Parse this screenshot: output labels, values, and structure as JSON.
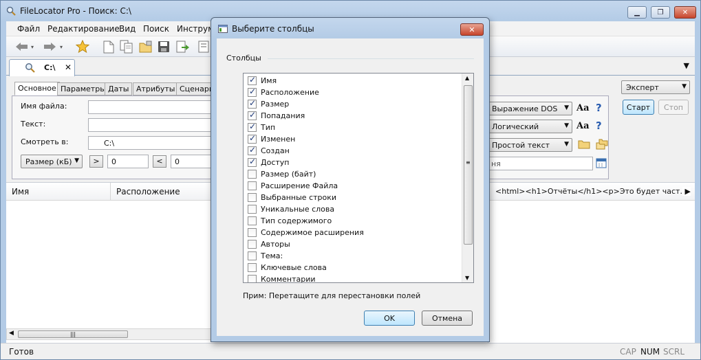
{
  "app": {
    "title": "FileLocator Pro - Поиск: C:\\",
    "menu": [
      "Файл",
      "Редактирование",
      "Вид",
      "Поиск",
      "Инструм"
    ],
    "doc_tab": "C:\\",
    "subtabs": [
      "Основное",
      "Параметры",
      "Даты",
      "Атрибуты",
      "Сценари"
    ],
    "labels": {
      "file_name": "Имя файла:",
      "text": "Текст:",
      "look_in": "Смотреть в:"
    },
    "look_in_value": "C:\\",
    "size_combo": "Размер (кБ)",
    "gt": ">",
    "lt": "<",
    "size_min": "0",
    "size_max": "0",
    "expr_combos": [
      "Выражение DOS",
      "Логический",
      "Простой текст"
    ],
    "aa": "Aa",
    "date_field": "ня",
    "mode_combo": "Эксперт",
    "start": "Старт",
    "stop": "Стоп",
    "columns": {
      "name": "Имя",
      "location": "Расположение"
    },
    "preview_text": "<html><h1>Отчёты</h1><p>Это будет част…",
    "status": "Готов",
    "indicators": [
      "CAP",
      "NUM",
      "SCRL"
    ]
  },
  "dialog": {
    "title": "Выберите столбцы",
    "group_label": "Столбцы",
    "items": [
      {
        "label": "Имя",
        "checked": true
      },
      {
        "label": "Расположение",
        "checked": true
      },
      {
        "label": "Размер",
        "checked": true
      },
      {
        "label": "Попадания",
        "checked": true
      },
      {
        "label": "Тип",
        "checked": true
      },
      {
        "label": "Изменен",
        "checked": true
      },
      {
        "label": "Создан",
        "checked": true
      },
      {
        "label": "Доступ",
        "checked": true
      },
      {
        "label": "Размер (байт)",
        "checked": false
      },
      {
        "label": "Расширение Файла",
        "checked": false
      },
      {
        "label": "Выбранные строки",
        "checked": false
      },
      {
        "label": "Уникальные слова",
        "checked": false
      },
      {
        "label": "Тип содержимого",
        "checked": false
      },
      {
        "label": "Содержимое расширения",
        "checked": false
      },
      {
        "label": "Авторы",
        "checked": false
      },
      {
        "label": "Тема:",
        "checked": false
      },
      {
        "label": "Ключевые слова",
        "checked": false
      },
      {
        "label": "Комментарии",
        "checked": false
      }
    ],
    "hint": "Прим: Перетащите для перестановки полей",
    "ok": "OK",
    "cancel": "Отмена"
  }
}
